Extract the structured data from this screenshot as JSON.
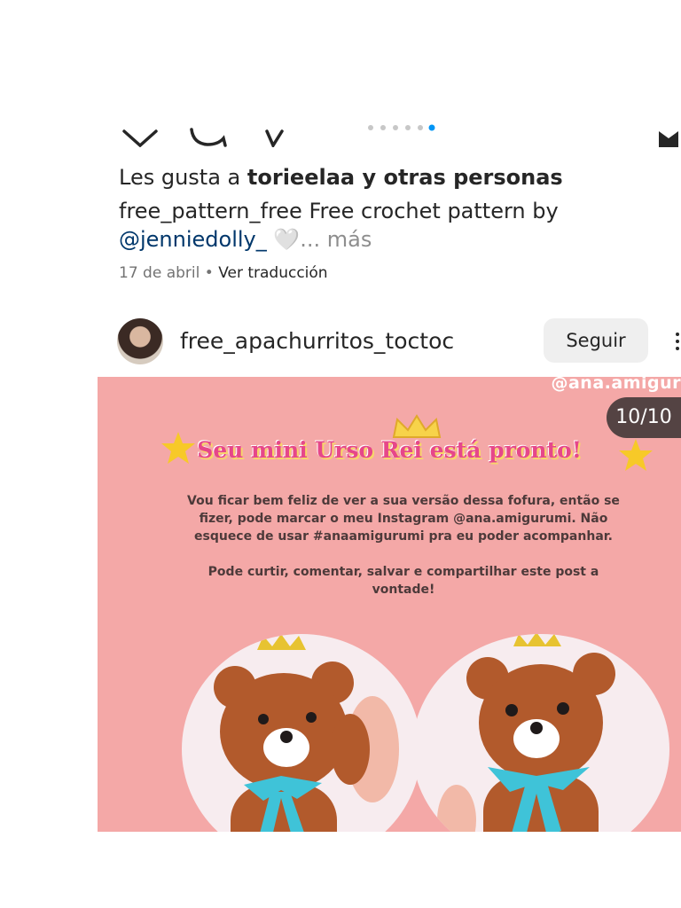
{
  "likes": {
    "prefix": "Les gusta a ",
    "user": "torieelaa",
    "suffix": " y otras personas"
  },
  "caption": {
    "account": "free_pattern_free",
    "text": " Free crochet pattern by ",
    "mention": "@jenniedolly_",
    "emoji": " 🤍",
    "more": "... más"
  },
  "meta": {
    "date": "17 de abril",
    "separator": " • ",
    "translate": "Ver traducción"
  },
  "next_post": {
    "username": "free_apachurritos_toctoc",
    "follow_label": "Seguir",
    "watermark": "@ana.amigur",
    "counter": "10/10",
    "image_title": "Seu mini Urso Rei está pronto!",
    "image_text_1": "Vou ficar bem feliz de ver a sua versão dessa fofura, então se fizer, pode marcar o meu Instagram @ana.amigurumi. Não esquece de usar #anaamigurumi pra eu poder acompanhar.",
    "image_text_2": "Pode curtir, comentar, salvar e compartilhar este post a vontade!"
  },
  "icons": [
    "heart-icon",
    "comment-icon",
    "share-icon",
    "bookmark-icon",
    "more-options-icon",
    "star-icon",
    "crown-icon"
  ],
  "colors": {
    "post_background": "#f4a8a7",
    "title_pink": "#e6478a",
    "mention_blue": "#00376b",
    "bow_blue": "#3fc3d8",
    "bear_brown": "#b25a2c"
  }
}
